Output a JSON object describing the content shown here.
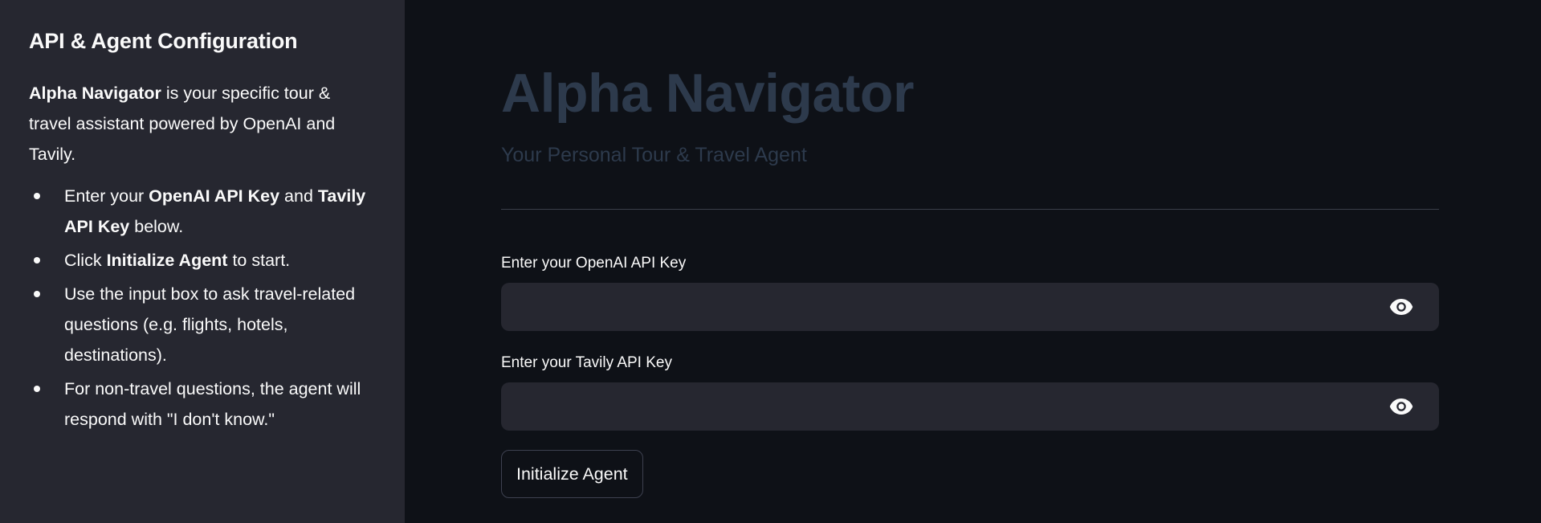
{
  "sidebar": {
    "title": "API & Agent Configuration",
    "intro_bold": "Alpha Navigator",
    "intro_rest": " is your specific tour & travel assistant powered by OpenAI and Tavily.",
    "items": [
      {
        "t1": "Enter your ",
        "b1": "OpenAI API Key",
        "t2": " and ",
        "b2": "Tavily API Key",
        "t3": " below."
      },
      {
        "t1": "Click ",
        "b1": "Initialize Agent",
        "t2": " to start."
      },
      {
        "t1": "Use the input box to ask travel-related questions (e.g. flights, hotels, destinations)."
      },
      {
        "t1": "For non-travel questions, the agent will respond with \"I don't know.\""
      }
    ]
  },
  "main": {
    "title": "Alpha Navigator",
    "subtitle": "Your Personal Tour & Travel Agent",
    "openai_field": {
      "label": "Enter your OpenAI API Key",
      "value": "",
      "icon": "eye-icon"
    },
    "tavily_field": {
      "label": "Enter your Tavily API Key",
      "value": "",
      "icon": "eye-icon"
    },
    "init_button_label": "Initialize Agent"
  },
  "colors": {
    "background": "#0e1117",
    "sidebar": "#262730",
    "input_bg": "#262730",
    "title": "#2d3a4c",
    "text": "#fafafa"
  }
}
